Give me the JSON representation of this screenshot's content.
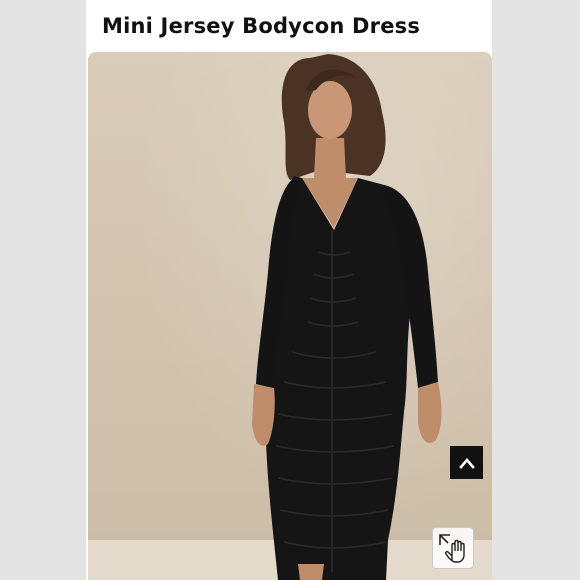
{
  "product": {
    "title": "Mini Jersey Bodycon Dress"
  },
  "photo": {
    "subject": "model wearing black ruched long-sleeve bodycon dress",
    "background_color": "#d5c7b3",
    "dress_color": "#111111"
  },
  "controls": {
    "scroll_top_icon": "chevron-up-icon",
    "zoom_icon": "expand-hand-pointer-icon"
  }
}
